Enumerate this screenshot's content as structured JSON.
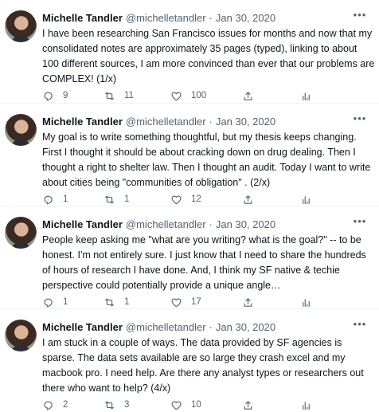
{
  "tweets": [
    {
      "name": "Michelle Tandler",
      "handle": "@michelletandler",
      "date": "Jan 30, 2020",
      "text": "I have been researching San Francisco issues for months and now that my consolidated notes are approximately 35 pages (typed), linking to about 100 different sources, I am more convinced than ever that our problems are COMPLEX! (1/x)",
      "replies": "9",
      "retweets": "11",
      "likes": "100"
    },
    {
      "name": "Michelle Tandler",
      "handle": "@michelletandler",
      "date": "Jan 30, 2020",
      "text": "My goal is to write something thoughtful, but my thesis keeps changing. First I thought it should be about cracking down on drug dealing. Then I thought a right to shelter law. Then I thought an audit. Today I want to write about cities being \"communities of obligation\" . (2/x)",
      "replies": "1",
      "retweets": "1",
      "likes": "12"
    },
    {
      "name": "Michelle Tandler",
      "handle": "@michelletandler",
      "date": "Jan 30, 2020",
      "text": "People keep asking me \"what are you writing? what is the goal?\" -- to be honest. I'm not entirely sure. I just know that I need to share the hundreds of hours of research I have done. And, I think my SF native & techie perspective could potentially provide a unique angle…",
      "replies": "1",
      "retweets": "1",
      "likes": "17"
    },
    {
      "name": "Michelle Tandler",
      "handle": "@michelletandler",
      "date": "Jan 30, 2020",
      "text": "I am stuck in a couple of ways. The data provided by SF agencies is sparse. The data sets available are so large they crash excel and my macbook pro. I need help. Are there any analyst types or researchers out there who want to help? (4/x)",
      "replies": "2",
      "retweets": "3",
      "likes": "10"
    }
  ],
  "separator": "·",
  "more_glyph": "•••"
}
